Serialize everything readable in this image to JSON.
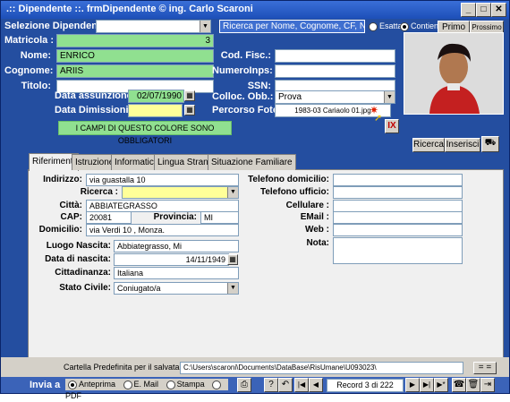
{
  "window": {
    "title": ".:: Dipendente ::.   frmDipendente © ing. Carlo Scaroni"
  },
  "header": {
    "selezione_label": "Selezione Dipendente :",
    "selezione_value": "",
    "search_placeholder": "Ricerca per Nome, Cognome, CF, Num_INPS",
    "esatta_label": "Esatta",
    "contiene_label": "Contiene",
    "primo_label": "Primo",
    "prossimo_label": "Prossimo"
  },
  "left": {
    "matricola_label": "Matricola :",
    "matricola_value": "3",
    "nome_label": "Nome:",
    "nome_value": "ENRICO",
    "cognome_label": "Cognome:",
    "cognome_value": "ARIIS",
    "titolo_label": "Titolo:",
    "titolo_value": "",
    "assunzione_label": "Data assunzione:",
    "assunzione_value": "02/07/1990",
    "dimissioni_label": "Data Dimissioni:",
    "dimissioni_value": "",
    "obbligatori_note": "I CAMPI DI QUESTO COLORE SONO OBBLIGATORI"
  },
  "right": {
    "codfisc_label": "Cod. Fisc.:",
    "codfisc_value": "",
    "numinps_label": "NumeroInps:",
    "numinps_value": "",
    "ssn_label": "SSN:",
    "ssn_value": "",
    "colloc_label": "Colloc. Obb.:",
    "colloc_value": "Prova",
    "percorso_label": "Percorso Foto:",
    "percorso_value": "1983-03 Cariaolo 01.jpg",
    "clear_label": "IX",
    "ricerca_label": "Ricerca",
    "inserisci_label": "Inserisci"
  },
  "tabs": [
    {
      "label": "Riferimenti"
    },
    {
      "label": "Istruzione"
    },
    {
      "label": "Informatica"
    },
    {
      "label": "Lingua Straniera"
    },
    {
      "label": "Situazione Familiare"
    }
  ],
  "riferimenti": {
    "indirizzo_label": "Indirizzo:",
    "indirizzo_value": "via guastalla 10",
    "ricerca_label": "Ricerca :",
    "ricerca_value": "",
    "citta_label": "Città:",
    "citta_value": "ABBIATEGRASSO",
    "cap_label": "CAP:",
    "cap_value": "20081",
    "provincia_label": "Provincia:",
    "provincia_value": "MI",
    "domicilio_label": "Domicilio:",
    "domicilio_value": "via Verdi 10 , Monza.",
    "luogo_label": "Luogo Nascita:",
    "luogo_value": "Abbiategrasso, Mi",
    "datanascita_label": "Data di nascita:",
    "datanascita_value": "14/11/1949",
    "cittadinanza_label": "Cittadinanza:",
    "cittadinanza_value": "Italiana",
    "stato_label": "Stato Civile:",
    "stato_value": "Coniugato/a",
    "tel_dom_label": "Telefono domicilio:",
    "tel_uff_label": "Telefono ufficio:",
    "cell_label": "Cellulare :",
    "email_label": "EMail :",
    "web_label": "Web :",
    "nota_label": "Nota:"
  },
  "footer": {
    "cartella_label": "Cartella Predefinita per il salvataggio :",
    "cartella_value": "C:\\Users\\scaroni\\Documents\\DataBase\\RisUmane\\U093023\\",
    "cartella_btn": "= =",
    "invia_label": "Invia a",
    "anteprima_label": "Anteprima",
    "email_label": "E. Mail",
    "stampa_label": "Stampa",
    "pdf_label": "PDF",
    "record_text": "Record 3 di 222"
  }
}
